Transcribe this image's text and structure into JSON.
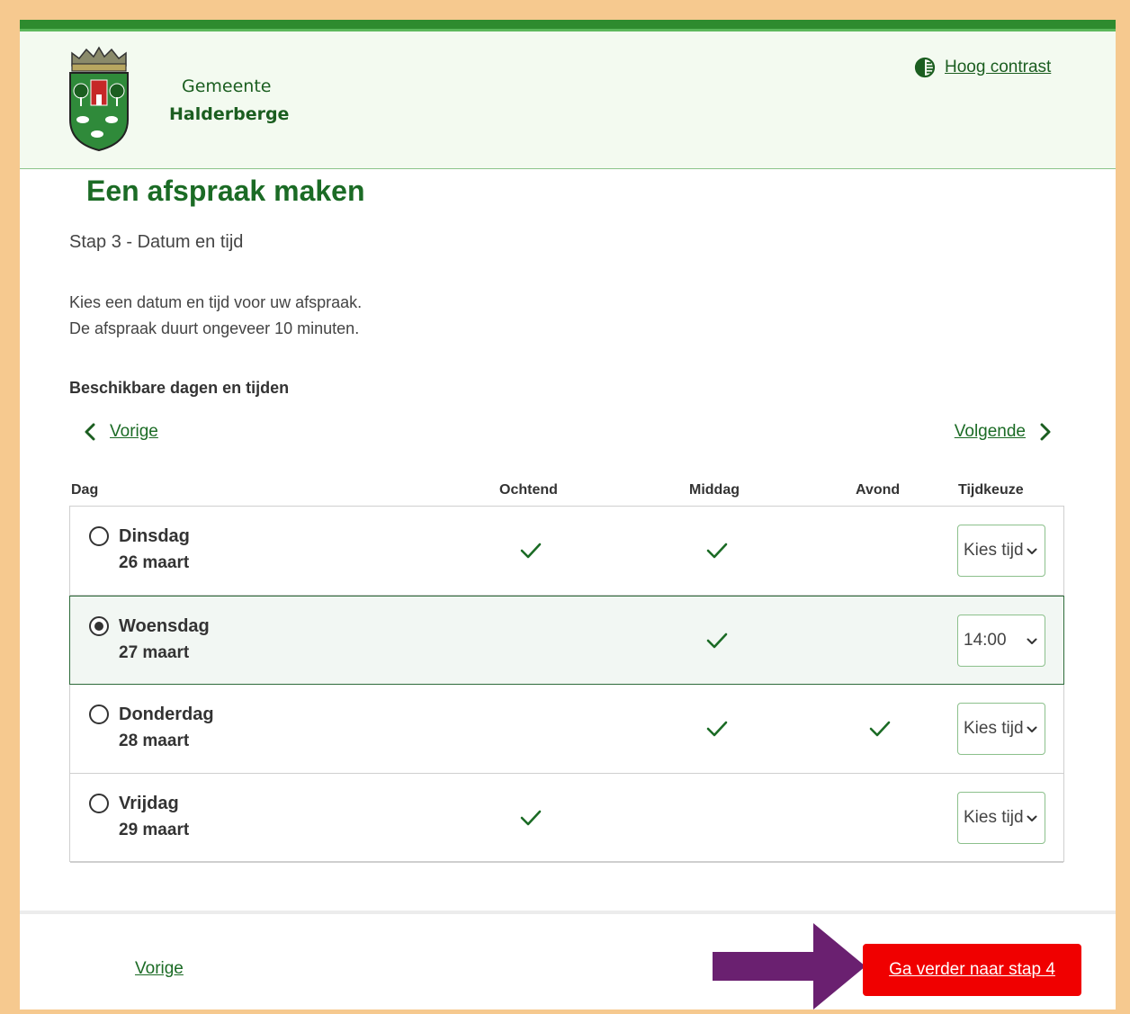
{
  "header": {
    "brand_line1": "Gemeente",
    "brand_line2": "Halderberge",
    "contrast_link": "Hoog contrast"
  },
  "main": {
    "title": "Een afspraak maken",
    "step": "Stap 3 - Datum en tijd",
    "intro_line1": "Kies een datum en tijd voor uw afspraak.",
    "intro_line2": "De afspraak duurt ongeveer 10 minuten.",
    "available_heading": "Beschikbare dagen en tijden",
    "prev_label": "Vorige",
    "next_label": "Volgende"
  },
  "table": {
    "columns": [
      "Dag",
      "Ochtend",
      "Middag",
      "Avond",
      "Tijdkeuze"
    ],
    "rows": [
      {
        "day": "Dinsdag",
        "date": "26 maart",
        "ochtend": true,
        "middag": true,
        "avond": false,
        "time": "Kies tijd",
        "selected": false
      },
      {
        "day": "Woensdag",
        "date": "27 maart",
        "ochtend": false,
        "middag": true,
        "avond": false,
        "time": "14:00",
        "selected": true
      },
      {
        "day": "Donderdag",
        "date": "28 maart",
        "ochtend": false,
        "middag": true,
        "avond": true,
        "time": "Kies tijd",
        "selected": false
      },
      {
        "day": "Vrijdag",
        "date": "29 maart",
        "ochtend": true,
        "middag": false,
        "avond": false,
        "time": "Kies tijd",
        "selected": false
      }
    ]
  },
  "footer": {
    "prev_label": "Vorige",
    "next_label": "Ga verder naar stap 4"
  },
  "colors": {
    "brand_green": "#1b6b25",
    "accent_bar": "#2e8b2e",
    "cta_red": "#f00000",
    "annotation_arrow": "#6a2070",
    "outer_border": "#f6c98f"
  },
  "icons": {
    "crest": "municipal-crest-icon",
    "contrast": "contrast-icon",
    "prev": "chevron-left-icon",
    "next": "chevron-right-icon",
    "check": "check-icon",
    "dropdown": "chevron-down-icon",
    "annotation": "arrow-right-icon"
  }
}
